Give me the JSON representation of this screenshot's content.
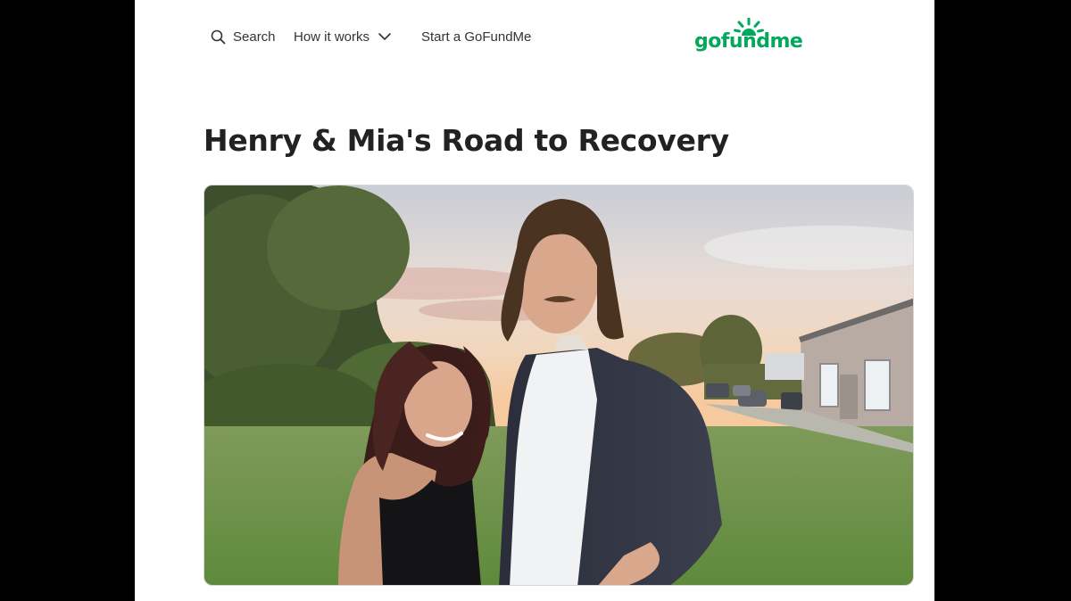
{
  "nav": {
    "search_label": "Search",
    "search_icon": "search-icon",
    "how_label": "How it works",
    "how_icon": "chevron-down-icon",
    "start_label": "Start a GoFundMe"
  },
  "logo": {
    "text": "gofundme",
    "color": "#02a95c"
  },
  "campaign": {
    "title": "Henry & Mia's Road to Recovery"
  }
}
